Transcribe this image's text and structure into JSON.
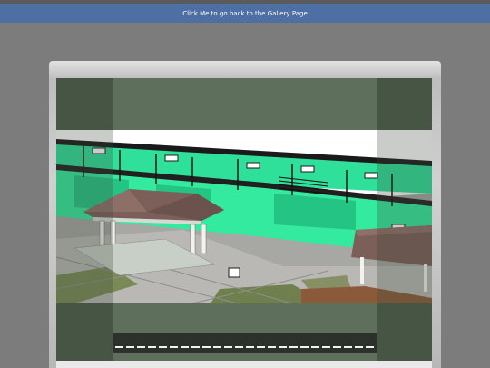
{
  "header": {
    "back_link_label": "Click Me to go back to the Gallery Page"
  },
  "colors": {
    "page_bg": "#7c7c7c",
    "banner_bg": "#4e6fa3",
    "wall_green": "#2ee69a",
    "roof_brown": "#7c5f59"
  },
  "viewer": {
    "image_subject": "3d-building-render",
    "filmstrip_icon": "dashed-line"
  }
}
